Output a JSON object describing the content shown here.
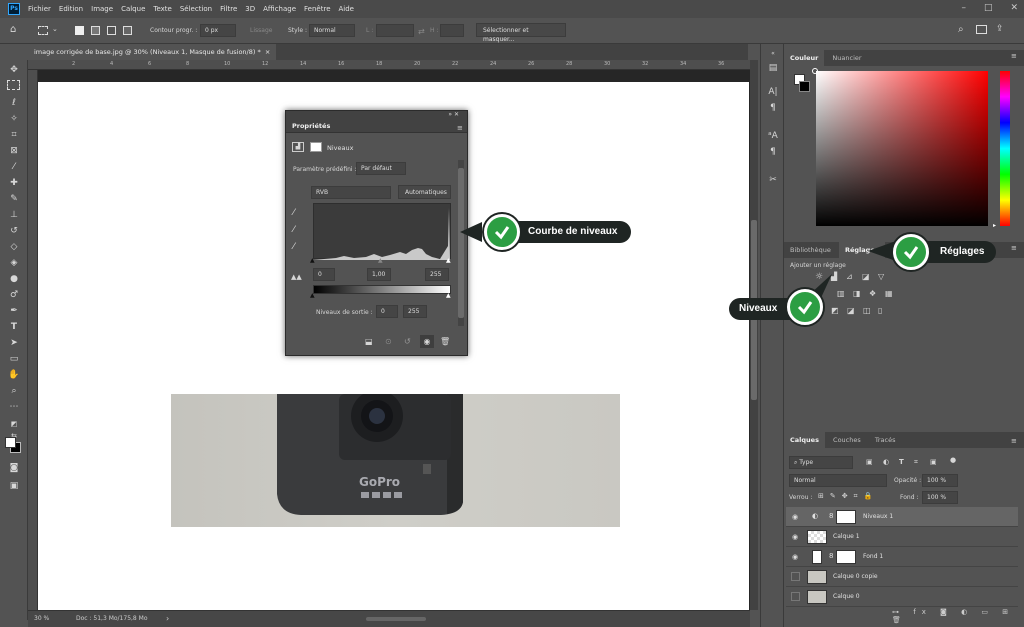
{
  "menubar": {
    "app_badge": "Ps",
    "items": [
      "Fichier",
      "Edition",
      "Image",
      "Calque",
      "Texte",
      "Sélection",
      "Filtre",
      "3D",
      "Affichage",
      "Fenêtre",
      "Aide"
    ]
  },
  "options_bar": {
    "contour_label": "Contour progr. :",
    "contour_value": "0 px",
    "lissage_label": "Lissage",
    "style_label": "Style :",
    "style_value": "Normal",
    "l_label": "L :",
    "h_label": "H :",
    "select_mask_button": "Sélectionner et masquer..."
  },
  "document_tab": {
    "title": "image corrigée de base.jpg @ 30% (Niveaux 1, Masque de fusion/8) *",
    "close": "×"
  },
  "ruler_ticks": [
    "2",
    "4",
    "6",
    "8",
    "10",
    "12",
    "14",
    "16",
    "18",
    "20",
    "22",
    "24",
    "26",
    "28",
    "30",
    "32",
    "34",
    "36"
  ],
  "statusbar": {
    "zoom": "30 %",
    "doc_info": "Doc : 51,3 Mo/175,8 Mo"
  },
  "properties_panel": {
    "title": "Propriétés",
    "layer_type": "Niveaux",
    "preset_label": "Paramètre prédéfini :",
    "preset_value": "Par défaut",
    "channel_value": "RVB",
    "auto_button": "Automatiques",
    "input_black": "0",
    "input_gamma": "1,00",
    "input_white": "255",
    "output_label": "Niveaux de sortie :",
    "output_black": "0",
    "output_white": "255"
  },
  "callouts": {
    "curve": "Courbe de niveaux",
    "adjustments": "Réglages",
    "levels": "Niveaux"
  },
  "color_panel": {
    "tab_color": "Couleur",
    "tab_swatches": "Nuancier"
  },
  "adjustments_panel": {
    "tab_libraries": "Bibliothèque",
    "tab_adjustments": "Réglages",
    "add_label": "Ajouter un réglage"
  },
  "layers_panel": {
    "tab_layers": "Calques",
    "tab_channels": "Couches",
    "tab_paths": "Tracés",
    "filter_value": "Type",
    "blend_mode": "Normal",
    "opacity_label": "Opacité :",
    "opacity_value": "100 %",
    "lock_label": "Verrou :",
    "fill_label": "Fond :",
    "fill_value": "100 %",
    "layers": [
      {
        "name": "Niveaux 1",
        "visible": true
      },
      {
        "name": "Calque 1",
        "visible": true
      },
      {
        "name": "Fond 1",
        "visible": true
      },
      {
        "name": "Calque 0 copie",
        "visible": false
      },
      {
        "name": "Calque 0",
        "visible": false
      }
    ]
  },
  "photo": {
    "brand_text": "GoPro"
  },
  "colors": {
    "callout_bg": "#1f2523",
    "check_green": "#2c9e43",
    "ps_blue": "#31a8ff"
  }
}
